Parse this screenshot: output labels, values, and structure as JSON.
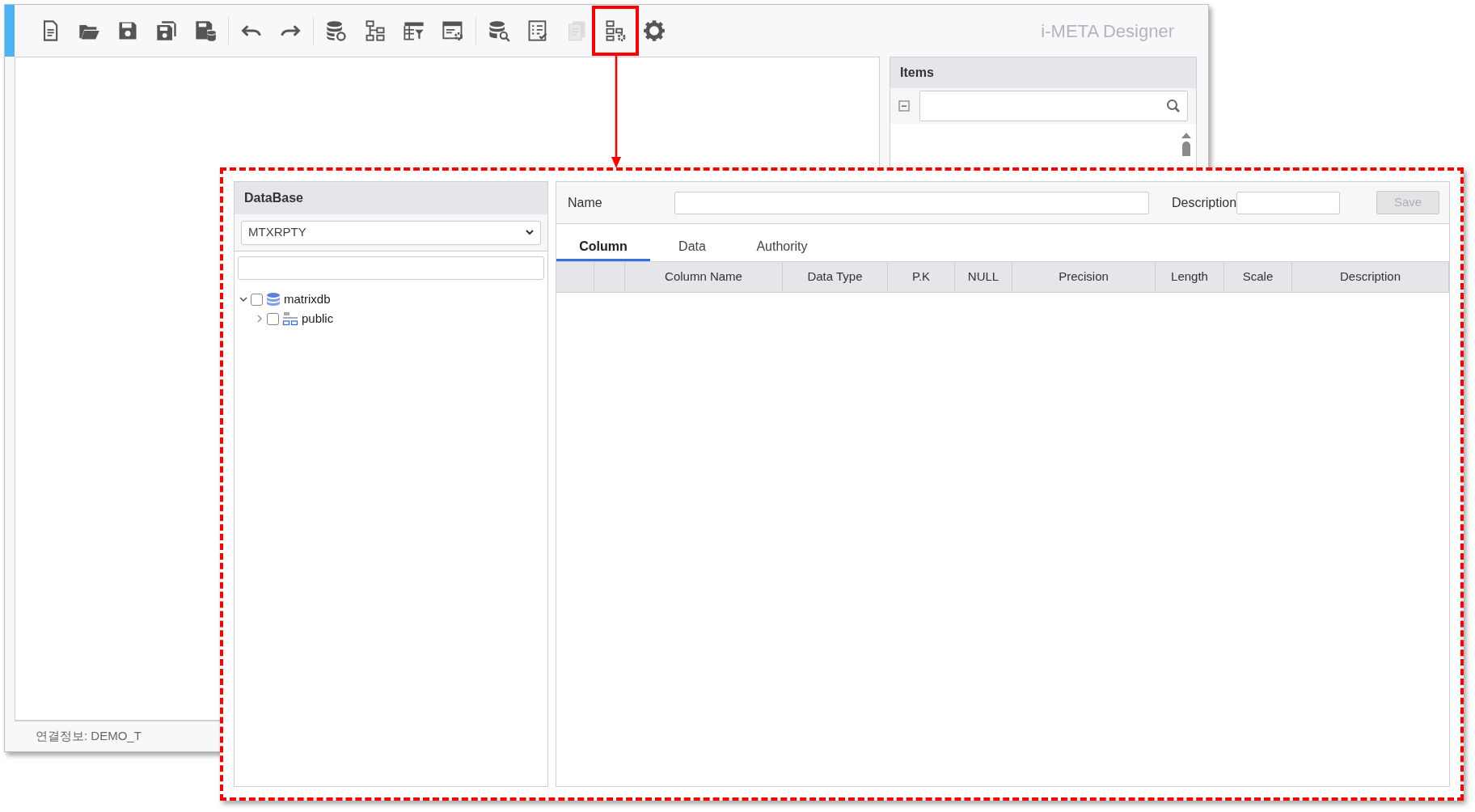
{
  "window": {
    "title": "i-META Designer"
  },
  "toolbar": {
    "groups": [
      {
        "buttons": [
          {
            "highlighted": false,
            "disabled": false
          },
          {
            "highlighted": false,
            "disabled": false
          },
          {
            "highlighted": false,
            "disabled": false
          },
          {
            "highlighted": false,
            "disabled": false
          },
          {
            "highlighted": false,
            "disabled": false
          }
        ]
      },
      {
        "buttons": [
          {
            "highlighted": false,
            "disabled": false
          },
          {
            "highlighted": false,
            "disabled": false
          }
        ]
      },
      {
        "buttons": [
          {
            "highlighted": false,
            "disabled": false
          },
          {
            "highlighted": false,
            "disabled": false
          },
          {
            "highlighted": false,
            "disabled": false
          },
          {
            "highlighted": false,
            "disabled": false
          }
        ]
      },
      {
        "buttons": [
          {
            "highlighted": false,
            "disabled": false
          },
          {
            "highlighted": false,
            "disabled": false
          },
          {
            "highlighted": false,
            "disabled": true
          },
          {
            "highlighted": true,
            "disabled": false
          },
          {
            "highlighted": false,
            "disabled": false
          }
        ]
      }
    ]
  },
  "items_panel": {
    "title": "Items"
  },
  "status_bar": {
    "text": "연결정보: DEMO_T"
  },
  "dialog": {
    "database_panel": {
      "title": "DataBase",
      "selected_database": "MTXRPTY",
      "tree": [
        {
          "label": "matrixdb",
          "kind": "database",
          "checked": false,
          "expanded": true,
          "children": [
            {
              "label": "public",
              "kind": "schema",
              "checked": false,
              "expanded": false
            }
          ]
        }
      ]
    },
    "form": {
      "name_label": "Name",
      "description_label": "Description",
      "save_button": {
        "label": "Save",
        "disabled": true
      }
    },
    "tabs": [
      {
        "label": "Column",
        "selected": true
      },
      {
        "label": "Data",
        "selected": false
      },
      {
        "label": "Authority",
        "selected": false
      }
    ],
    "table": {
      "columns": [
        "Column Name",
        "Data Type",
        "P.K",
        "NULL",
        "Precision",
        "Length",
        "Scale",
        "Description"
      ]
    }
  }
}
